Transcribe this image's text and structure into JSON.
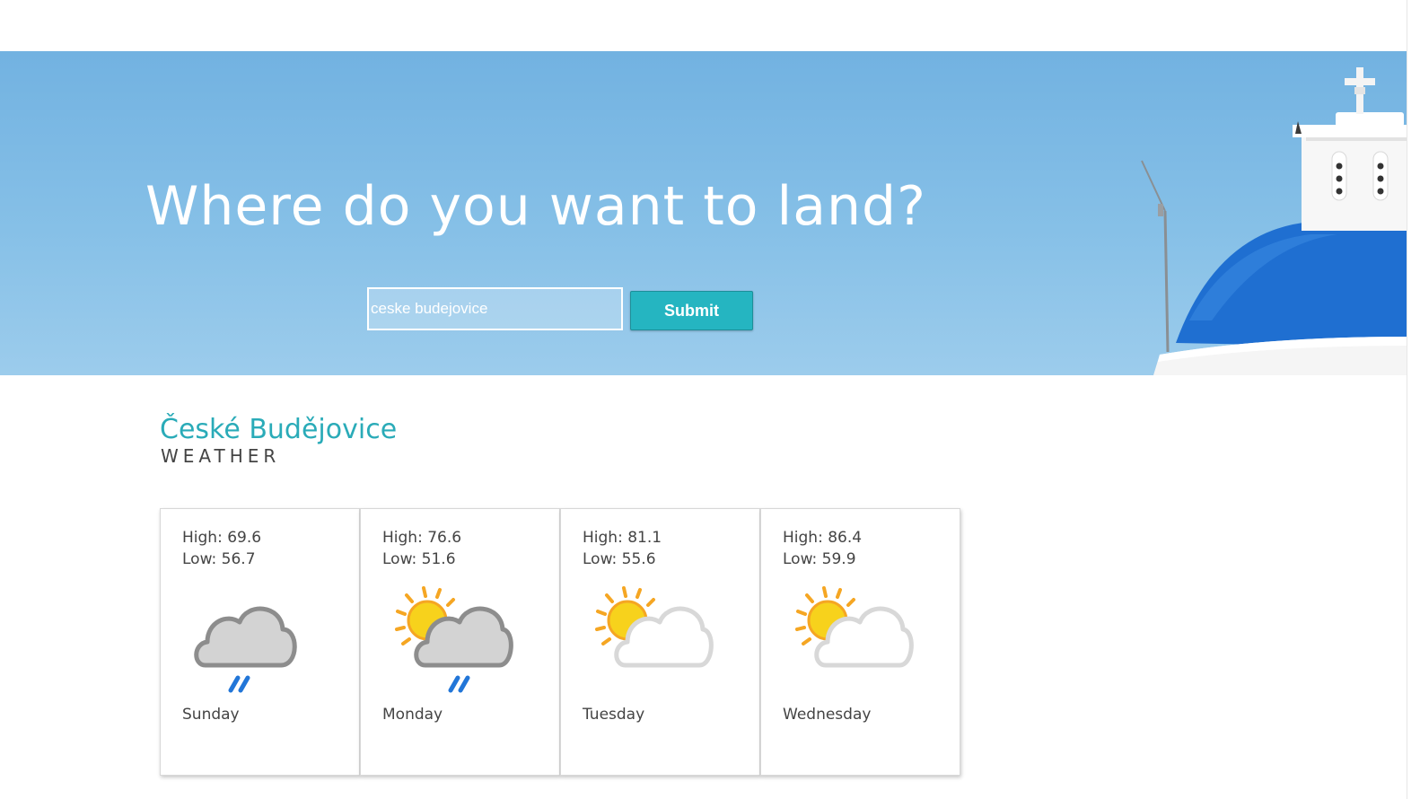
{
  "hero": {
    "title": "Where do you want to land?",
    "search_value": "ceske budejovice",
    "submit_label": "Submit"
  },
  "weather": {
    "city": "České Budějovice",
    "subtitle": "WEATHER",
    "days": [
      {
        "high": "High: 69.6",
        "low": "Low: 56.7",
        "day": "Sunday",
        "icon": "cloud-rain-icon"
      },
      {
        "high": "High: 76.6",
        "low": "Low: 51.6",
        "day": "Monday",
        "icon": "sun-cloud-rain-icon"
      },
      {
        "high": "High: 81.1",
        "low": "Low: 55.6",
        "day": "Tuesday",
        "icon": "partly-cloudy-icon"
      },
      {
        "high": "High: 86.4",
        "low": "Low: 59.9",
        "day": "Wednesday",
        "icon": "partly-cloudy-icon"
      }
    ]
  },
  "colors": {
    "accent": "#25b5c1",
    "city_title": "#2aabb8",
    "sky": "#7ab8e3",
    "dome": "#1f6fd1"
  }
}
